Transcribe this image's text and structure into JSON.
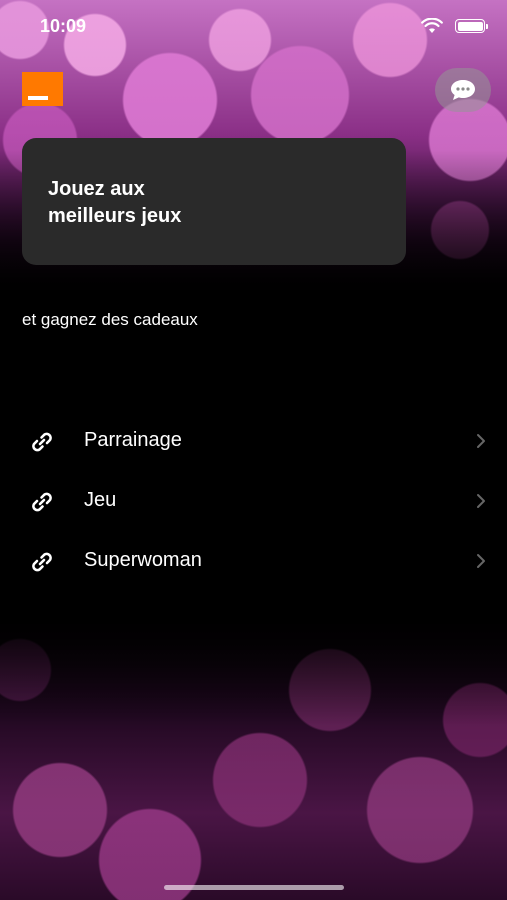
{
  "status_bar": {
    "time": "10:09"
  },
  "brand": {
    "logo_color": "#ff7900"
  },
  "header": {
    "chat_icon": "chat-bubble-icon"
  },
  "promo_card": {
    "title": "Jouez aux\nmeilleurs jeux"
  },
  "subtitle": "et gagnez des cadeaux",
  "menu": {
    "items": [
      {
        "label": "Parrainage",
        "icon": "link-icon"
      },
      {
        "label": "Jeu",
        "icon": "link-icon"
      },
      {
        "label": "Superwoman",
        "icon": "link-icon"
      }
    ]
  },
  "colors": {
    "accent": "#ff7900",
    "card_bg": "#2a2a2a",
    "background": "#000000"
  }
}
